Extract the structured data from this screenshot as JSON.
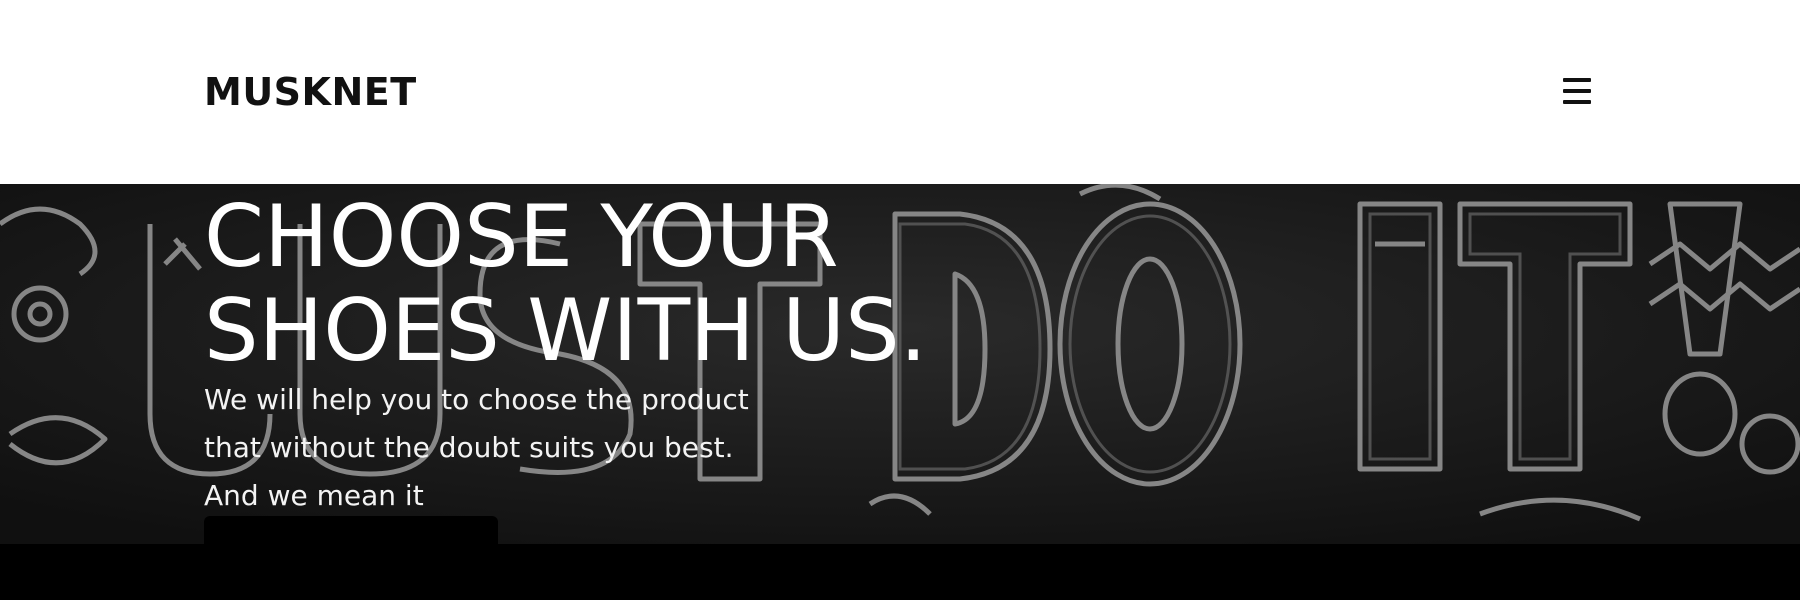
{
  "header": {
    "logo": "MUSKNET",
    "menu_icon": "hamburger-menu-icon"
  },
  "hero": {
    "title": "CHOOSE YOUR\nSHOES WITH US.",
    "text_lines": [
      "We will help you to choose the product",
      "that without the doubt suits you best.",
      "And we mean it"
    ],
    "cta_label": "",
    "background": "neon-sign-illustration"
  },
  "colors": {
    "header_bg": "#ffffff",
    "hero_bg": "#141414",
    "neon_stroke": "#8a8a8a",
    "text_light": "#ffffff",
    "footer_bg": "#000000"
  }
}
